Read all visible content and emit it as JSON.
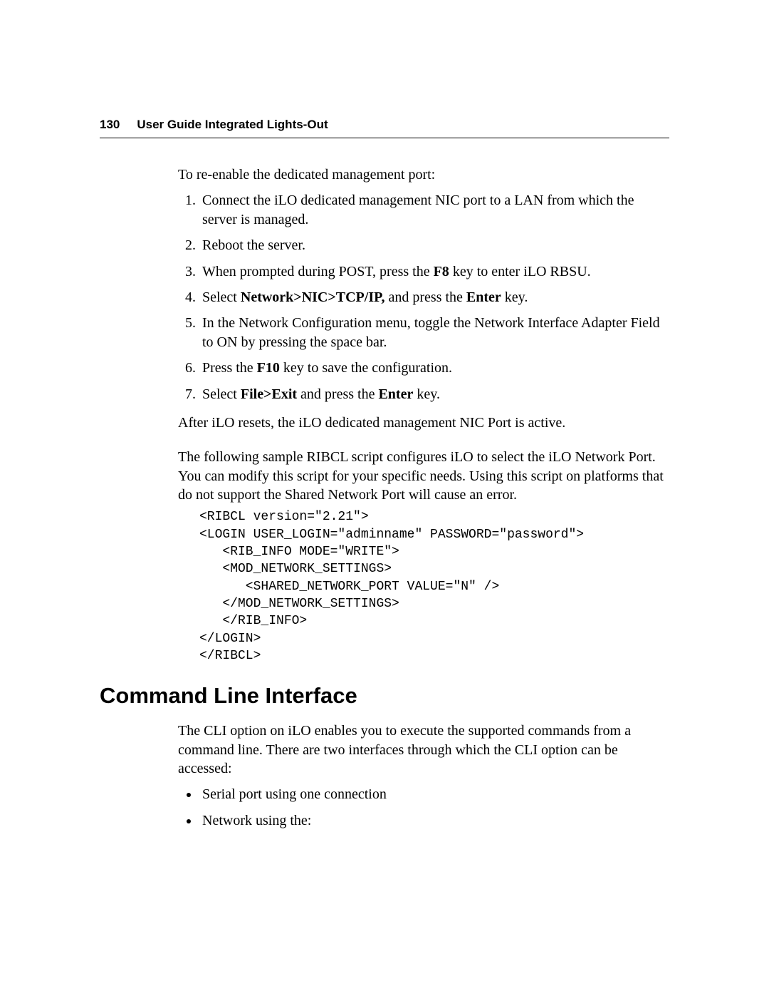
{
  "header": {
    "page_number": "130",
    "title": "User Guide Integrated Lights-Out"
  },
  "intro": "To re-enable the dedicated management port:",
  "steps": {
    "s1": "Connect the iLO dedicated management NIC port to a LAN from which the server is managed.",
    "s2": "Reboot the server.",
    "s3a": "When prompted during POST, press the ",
    "s3b": "F8",
    "s3c": " key to enter iLO RBSU.",
    "s4a": "Select ",
    "s4b": "Network>NIC>TCP/IP,",
    "s4c": " and press the ",
    "s4d": "Enter",
    "s4e": " key.",
    "s5": "In the Network Configuration menu, toggle the Network Interface Adapter Field to ON by pressing the space bar.",
    "s6a": "Press the ",
    "s6b": "F10",
    "s6c": " key to save the configuration.",
    "s7a": "Select ",
    "s7b": "File>Exit",
    "s7c": " and press the ",
    "s7d": "Enter",
    "s7e": " key."
  },
  "after_steps": "After iLO resets,  the iLO dedicated  management NIC Port is active.",
  "script_intro": "The following sample RIBCL script configures iLO to select the iLO Network Port. You can modify this script for your specific needs. Using this script on platforms that do not support the Shared Network Port will cause an error.",
  "code": "<RIBCL version=\"2.21\">\n<LOGIN USER_LOGIN=\"adminname\" PASSWORD=\"password\">\n   <RIB_INFO MODE=\"WRITE\">\n   <MOD_NETWORK_SETTINGS>\n      <SHARED_NETWORK_PORT VALUE=\"N\" />\n   </MOD_NETWORK_SETTINGS>\n   </RIB_INFO>\n</LOGIN>\n</RIBCL>",
  "section_heading": "Command Line Interface",
  "cli_intro": "The CLI option on iLO enables you to execute the supported commands from a command line. There are two interfaces through which the CLI option can be accessed:",
  "bullets": {
    "b1": "Serial port using one connection",
    "b2": "Network using the:"
  }
}
